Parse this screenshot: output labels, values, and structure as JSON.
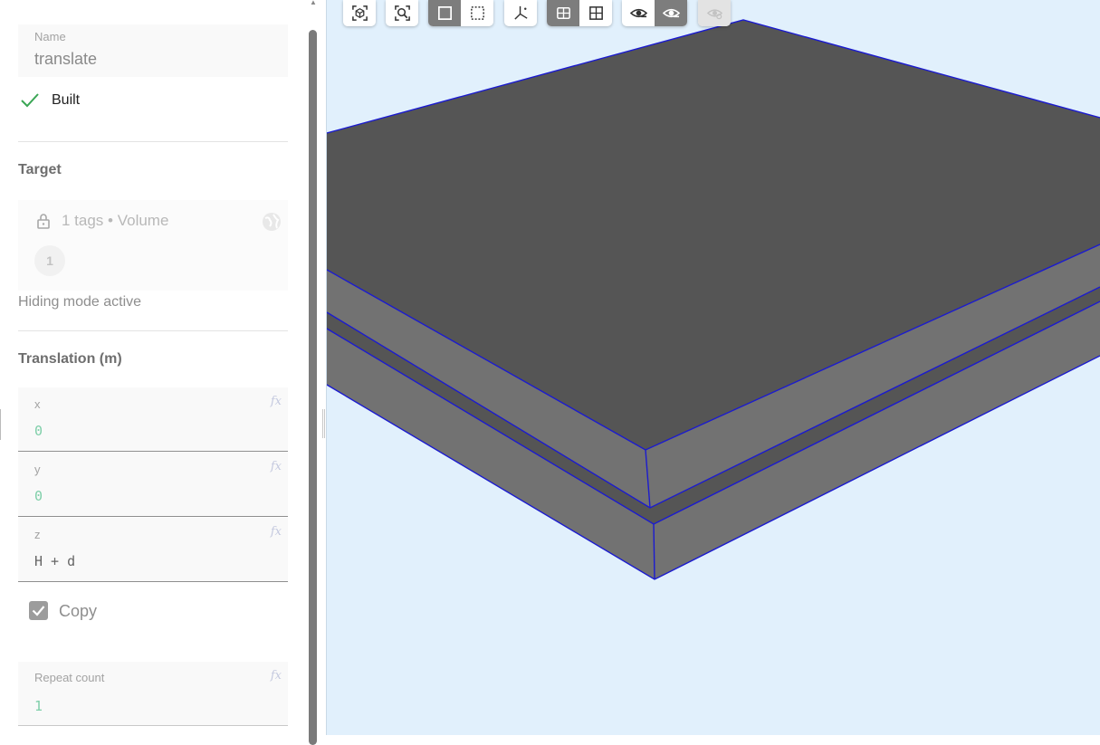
{
  "name_field": {
    "label": "Name",
    "value": "translate"
  },
  "status": {
    "text": "Built"
  },
  "target": {
    "title": "Target",
    "summary": "1 tags • Volume",
    "chip": "1",
    "hint": "Hiding mode active"
  },
  "translation": {
    "title": "Translation (m)",
    "x": {
      "label": "x",
      "value": "0"
    },
    "y": {
      "label": "y",
      "value": "0"
    },
    "z": {
      "label": "z",
      "value": "H + d"
    },
    "fx_label": "fx"
  },
  "copy": {
    "label": "Copy",
    "checked": true
  },
  "repeat": {
    "label": "Repeat count",
    "value": "1"
  },
  "toolbar": {
    "buttons": [
      {
        "icon": "focus-object-icon",
        "active": false
      },
      {
        "icon": "zoom-fit-icon",
        "active": false
      },
      {
        "icon": "select-solid-icon",
        "active": true
      },
      {
        "icon": "select-box-icon",
        "active": false
      },
      {
        "icon": "axes-icon",
        "active": false
      },
      {
        "icon": "section-view-icon",
        "active": true
      },
      {
        "icon": "grid-view-icon",
        "active": false
      },
      {
        "icon": "hide-icon",
        "active": false
      },
      {
        "icon": "show-icon",
        "active": true
      },
      {
        "icon": "show-all-icon",
        "active": false,
        "disabled": true
      }
    ]
  },
  "colors": {
    "viewport_bg": "#e1f0fc",
    "top_face": "#555555",
    "side_face": "#727272",
    "edge": "#1b1bcf",
    "check": "#3aa655"
  }
}
